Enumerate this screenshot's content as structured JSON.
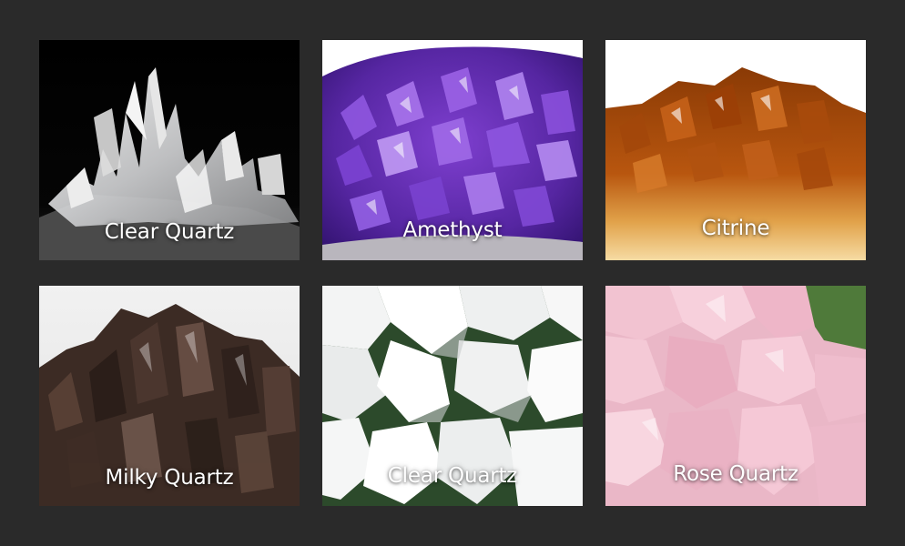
{
  "crystals": [
    {
      "name": "Clear Quartz"
    },
    {
      "name": "Amethyst"
    },
    {
      "name": "Citrine"
    },
    {
      "name": "Milky Quartz"
    },
    {
      "name": "Clear Quartz"
    },
    {
      "name": "Rose Quartz"
    }
  ],
  "colors": {
    "background": "#2a2a2a",
    "label": "#ffffff"
  }
}
